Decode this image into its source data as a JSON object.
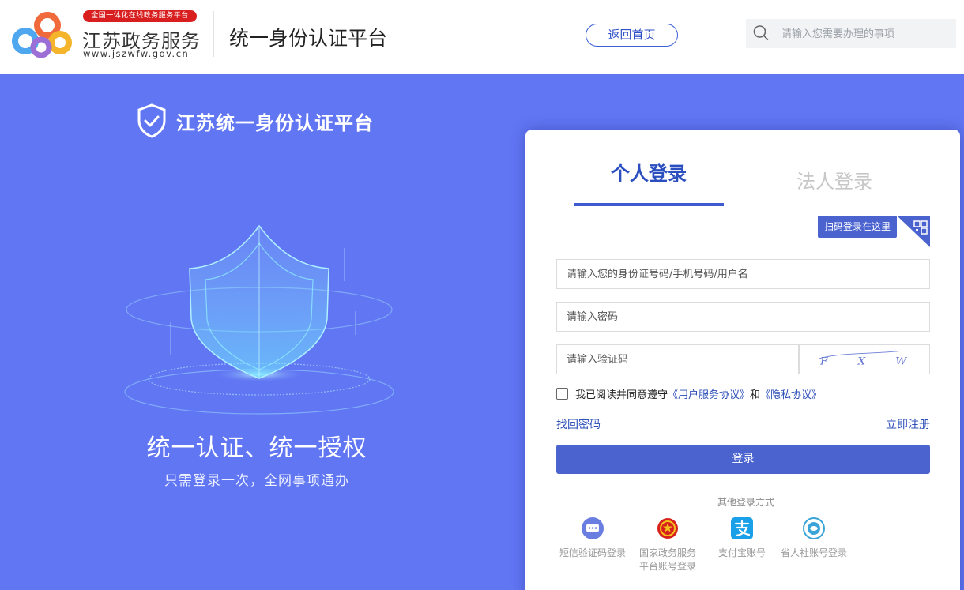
{
  "header": {
    "brand_badge": "全国一体化在线政务服务平台",
    "brand_name": "江苏政务服务",
    "brand_url": "www.jszwfw.gov.cn",
    "title": "统一身份认证平台",
    "home_button": "返回首页",
    "search_placeholder": "请输入您需要办理的事项",
    "search_value": ""
  },
  "hero": {
    "platform_name": "江苏统一身份认证平台",
    "slogan": "统一认证、统一授权",
    "subslogan": "只需登录一次，全网事项通办",
    "colors": {
      "background": "#6176f3",
      "accent": "#7ee8ff"
    }
  },
  "login": {
    "tabs": [
      {
        "label": "个人登录",
        "active": true
      },
      {
        "label": "法人登录",
        "active": false
      }
    ],
    "qr_tip": "扫码登录在这里",
    "account_placeholder": "请输入您的身份证号码/手机号码/用户名",
    "password_placeholder": "请输入密码",
    "captcha_placeholder": "请输入验证码",
    "captcha_text": "F X W R",
    "agree": {
      "checked": false,
      "prefix": "我已阅读并同意遵守",
      "service_link": "《用户服务协议》",
      "conjunction": "和",
      "privacy_link": "《隐私协议》"
    },
    "find_password": "找回密码",
    "register": "立即注册",
    "submit": "登录",
    "other_title": "其他登录方式",
    "other_methods": [
      {
        "icon": "sms-icon",
        "label": "短信验证码登录"
      },
      {
        "icon": "national-emblem-icon",
        "label": "国家政务服务",
        "label2": "平台账号登录"
      },
      {
        "icon": "alipay-icon",
        "label": "支付宝账号"
      },
      {
        "icon": "social-security-icon",
        "label": "省人社账号登录"
      }
    ],
    "colors": {
      "primary": "#4a63cf",
      "link": "#2d4fb8"
    }
  }
}
